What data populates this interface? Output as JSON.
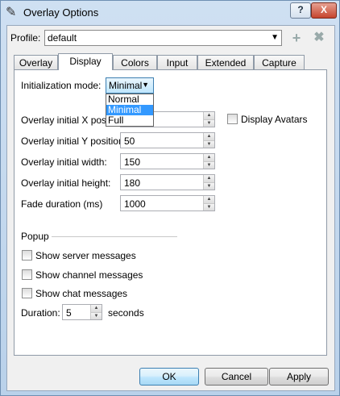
{
  "window": {
    "title": "Overlay Options",
    "help_label": "?",
    "close_label": "X"
  },
  "profile": {
    "label": "Profile:",
    "value": "default",
    "add_icon": "+",
    "remove_icon": "✖"
  },
  "tabs": [
    "Overlay",
    "Display",
    "Colors",
    "Input",
    "Extended",
    "Capture"
  ],
  "display": {
    "init_mode_label": "Initialization mode:",
    "init_mode_value": "Minimal",
    "init_mode_options": [
      "Normal",
      "Minimal",
      "Full"
    ],
    "x_label": "Overlay initial X posi",
    "y_label": "Overlay initial Y position:",
    "y_value": "50",
    "width_label": "Overlay initial width:",
    "width_value": "150",
    "height_label": "Overlay initial height:",
    "height_value": "180",
    "fade_label": "Fade duration (ms)",
    "fade_value": "1000",
    "avatars_label": "Display Avatars"
  },
  "popup": {
    "header": "Popup",
    "server_label": "Show server messages",
    "channel_label": "Show channel messages",
    "chat_label": "Show chat messages",
    "duration_label": "Duration:",
    "duration_value": "5",
    "seconds_label": "seconds"
  },
  "buttons": {
    "ok": "OK",
    "cancel": "Cancel",
    "apply": "Apply"
  }
}
